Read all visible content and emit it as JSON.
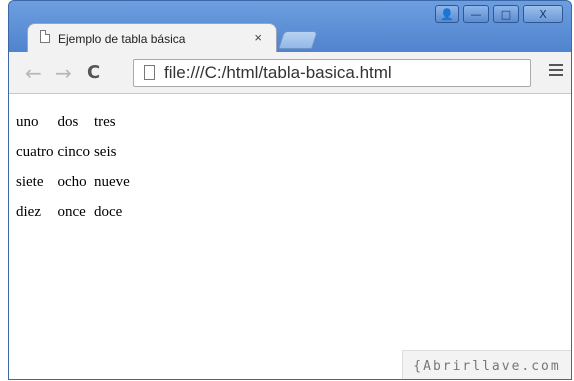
{
  "tab": {
    "title": "Ejemplo de tabla básica",
    "close_glyph": "×"
  },
  "toolbar": {
    "back_glyph": "←",
    "forward_glyph": "→",
    "reload_glyph": "C",
    "url": "file:///C:/html/tabla-basica.html"
  },
  "window": {
    "user_glyph": "👤",
    "minimize_glyph": "—",
    "maximize_glyph": "□",
    "close_glyph": "X"
  },
  "table": {
    "rows": [
      [
        "uno",
        "dos",
        "tres"
      ],
      [
        "cuatro",
        "cinco",
        "seis"
      ],
      [
        "siete",
        "ocho",
        "nueve"
      ],
      [
        "diez",
        "once",
        "doce"
      ]
    ]
  },
  "watermark": "{Abrirllave.com"
}
